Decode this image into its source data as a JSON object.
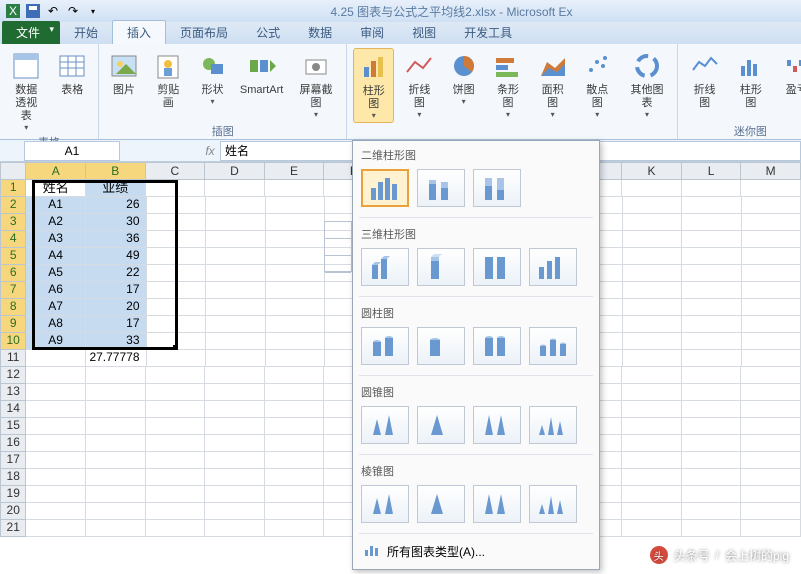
{
  "window_title": "4.25 图表与公式之平均线2.xlsx - Microsoft Ex",
  "tabs": {
    "file": "文件",
    "home": "开始",
    "insert": "插入",
    "layout": "页面布局",
    "formula": "公式",
    "data": "数据",
    "review": "审阅",
    "view": "视图",
    "dev": "开发工具"
  },
  "ribbon": {
    "group1_label": "表格",
    "pivot": "数据\n透视表",
    "table": "表格",
    "group2_label": "插图",
    "pic": "图片",
    "clip": "剪贴画",
    "shape": "形状",
    "smartart": "SmartArt",
    "screenshot": "屏幕截图",
    "group3_label": "",
    "column": "柱形图",
    "line": "折线图",
    "pie": "饼图",
    "bar": "条形图",
    "area": "面积图",
    "scatter": "散点图",
    "other": "其他图表",
    "group4_label": "迷你图",
    "spark_line": "折线图",
    "spark_col": "柱形图",
    "spark_wl": "盈亏"
  },
  "namebox": "A1",
  "formula": "姓名",
  "columns": [
    "A",
    "B",
    "C",
    "D",
    "E",
    "F",
    "G",
    "H",
    "I",
    "J",
    "K",
    "L",
    "M"
  ],
  "rows": [
    1,
    2,
    3,
    4,
    5,
    6,
    7,
    8,
    9,
    10,
    11,
    12,
    13,
    14,
    15,
    16,
    17,
    18,
    19,
    20,
    21
  ],
  "cells": {
    "A1": "姓名",
    "B1": "业绩",
    "A2": "A1",
    "B2": "26",
    "A3": "A2",
    "B3": "30",
    "A4": "A3",
    "B4": "36",
    "A5": "A4",
    "B5": "49",
    "A6": "A5",
    "B6": "22",
    "A7": "A6",
    "B7": "17",
    "A8": "A7",
    "B8": "20",
    "A9": "A8",
    "B9": "17",
    "A10": "A9",
    "B10": "33",
    "B11": "27.77778"
  },
  "chartmenu": {
    "s1": "二维柱形图",
    "s2": "三维柱形图",
    "s3": "圆柱图",
    "s4": "圆锥图",
    "s5": "棱锥图",
    "all": "所有图表类型(A)..."
  },
  "watermark": {
    "prefix": "头条号",
    "name": "会上树的pig"
  },
  "chart_data": {
    "type": "bar",
    "title": "业绩",
    "categories": [
      "A1",
      "A2",
      "A3",
      "A4",
      "A5",
      "A6",
      "A7",
      "A8",
      "A9"
    ],
    "values": [
      26,
      30,
      36,
      49,
      22,
      17,
      20,
      17,
      33
    ],
    "average": 27.77778,
    "xlabel": "姓名",
    "ylabel": "业绩"
  }
}
